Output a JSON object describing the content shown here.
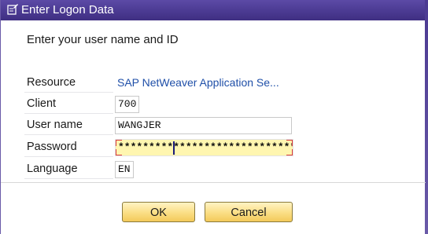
{
  "window": {
    "title": "Enter Logon Data",
    "icon": "edit-document-icon"
  },
  "form": {
    "heading": "Enter your user name and ID",
    "resource": {
      "label": "Resource",
      "value": "SAP NetWeaver Application Se..."
    },
    "client": {
      "label": "Client",
      "value": "700"
    },
    "username": {
      "label": "User name",
      "value": "WANGJER"
    },
    "password": {
      "label": "Password",
      "value": "********************************"
    },
    "language": {
      "label": "Language",
      "value": "EN"
    }
  },
  "buttons": {
    "ok_label": "OK",
    "cancel_label": "Cancel"
  },
  "colors": {
    "titlebar": "#4b3a92",
    "link": "#1f4fa8",
    "password_highlight": "#fff6b0",
    "required_marker": "#d93a3a",
    "button_face": "#fbe08a"
  }
}
